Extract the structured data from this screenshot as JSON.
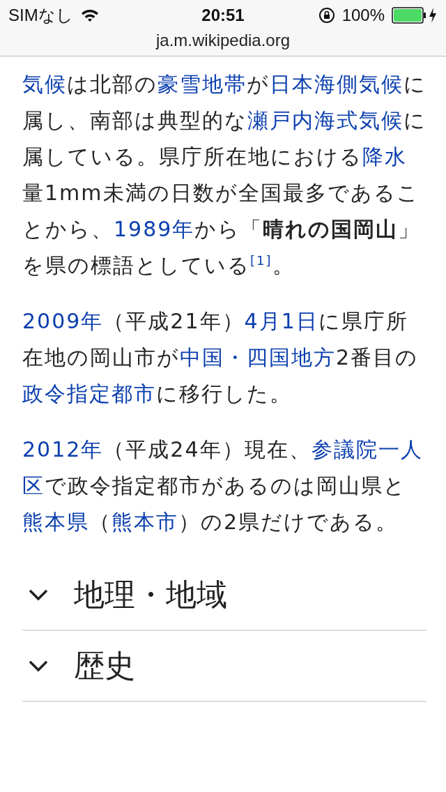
{
  "status_bar": {
    "carrier": "SIMなし",
    "time": "20:51",
    "battery": {
      "reading": "100%",
      "level": 1
    }
  },
  "address_bar": {
    "url": "ja.m.wikipedia.org"
  },
  "paragraphs": [
    {
      "segments": [
        {
          "kind": "link",
          "text": "気候"
        },
        {
          "kind": "text",
          "text": "は北部の"
        },
        {
          "kind": "link",
          "text": "豪雪地帯"
        },
        {
          "kind": "text",
          "text": "が"
        },
        {
          "kind": "link",
          "text": "日本海側気候"
        },
        {
          "kind": "text",
          "text": "に属し、南部は典型的な"
        },
        {
          "kind": "link",
          "text": "瀬戸内海式気候"
        },
        {
          "kind": "text",
          "text": "に属している。県庁所在地における"
        },
        {
          "kind": "link",
          "text": "降水"
        },
        {
          "kind": "text",
          "text": "量1mm未満の日数が全国最多であることから、"
        },
        {
          "kind": "link",
          "text": "1989年"
        },
        {
          "kind": "text",
          "text": "から「**晴れの国岡山**」を県の標語としている"
        },
        {
          "kind": "ref",
          "text": "[1]"
        },
        {
          "kind": "text",
          "text": "。"
        }
      ]
    },
    {
      "segments": [
        {
          "kind": "link",
          "text": "2009年"
        },
        {
          "kind": "text",
          "text": "（平成21年）"
        },
        {
          "kind": "link",
          "text": "4月1日"
        },
        {
          "kind": "text",
          "text": "に県庁所在地の岡山市が"
        },
        {
          "kind": "link",
          "text": "中国・四国地方"
        },
        {
          "kind": "text",
          "text": "2番目の"
        },
        {
          "kind": "link",
          "text": "政"
        },
        {
          "kind": "link",
          "text": "令指定都市"
        },
        {
          "kind": "text",
          "text": "に移行した。"
        }
      ]
    },
    {
      "segments": [
        {
          "kind": "link",
          "text": "2012年"
        },
        {
          "kind": "text",
          "text": "（平成24年）現在、"
        },
        {
          "kind": "link",
          "text": "参議院一人"
        },
        {
          "kind": "link",
          "text": "区"
        },
        {
          "kind": "text",
          "text": "で政令指定都市があるのは岡山県と"
        },
        {
          "kind": "link",
          "text": "熊"
        },
        {
          "kind": "link",
          "text": "本県"
        },
        {
          "kind": "text",
          "text": "（"
        },
        {
          "kind": "link",
          "text": "熊本市"
        },
        {
          "kind": "text",
          "text": "）の2県だけである。"
        }
      ]
    }
  ],
  "sections": [
    {
      "title": "地理・地域",
      "expanded": false
    },
    {
      "title": "歴史",
      "expanded": false
    }
  ]
}
